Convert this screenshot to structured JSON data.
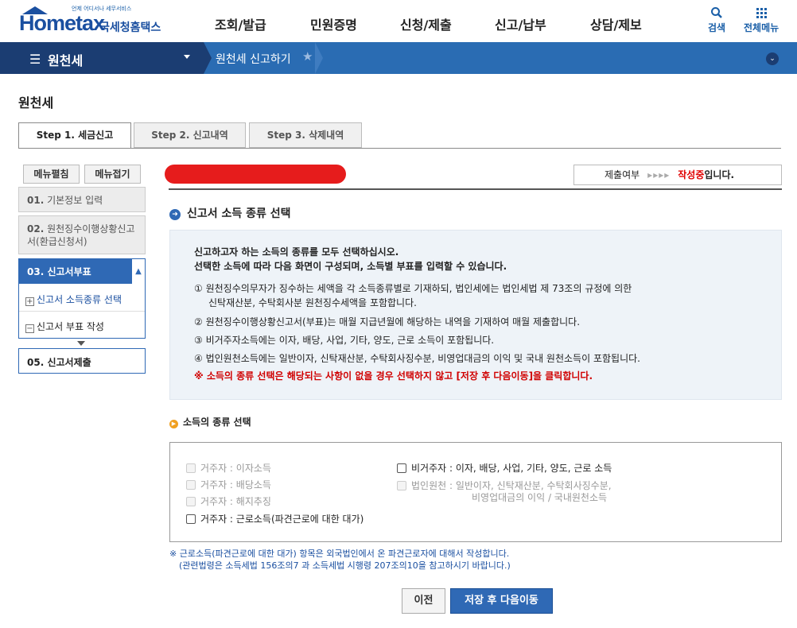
{
  "header": {
    "logo_tag": "언제 어디서나 세무서비스",
    "logo_word": "Hometax",
    "logo_kr": "국세청홈택스",
    "gnb": [
      "조회/발급",
      "민원증명",
      "신청/제출",
      "신고/납부",
      "상담/제보"
    ],
    "search_label": "검색",
    "allmenu_label": "전체메뉴"
  },
  "navbar": {
    "menu_label": "원천세",
    "crumb": "원천세 신고하기"
  },
  "page_title": "원천세",
  "tabs": [
    "Step 1. 세금신고",
    "Step 2. 신고내역",
    "Step 3. 삭제내역"
  ],
  "sidebar": {
    "expand_label": "메뉴펼침",
    "collapse_label": "메뉴접기",
    "steps": [
      {
        "num": "01.",
        "label": "기본정보 입력"
      },
      {
        "num": "02.",
        "label": "원천징수이행상황신고서(환급신청서)"
      },
      {
        "num": "03.",
        "label": "신고서부표"
      },
      {
        "num": "05.",
        "label": "신고서제출"
      }
    ],
    "sub_items": [
      "신고서 소득종류 선택",
      "신고서 부표 작성"
    ]
  },
  "status": {
    "label": "제출여부",
    "arrows": "▸▸▸▸",
    "value": "작성중",
    "suffix": "입니다."
  },
  "section_title": "신고서 소득 종류 선택",
  "info_lines": [
    "신고하고자 하는 소득의 종류를 모두 선택하십시오.",
    "선택한 소득에 따라 다음 화면이 구성되며, 소득별 부표를 입력할 수 있습니다.",
    "① 원천징수의무자가 징수하는 세액을 각 소득종류별로 기재하되, 법인세에는 법인세법 제 73조의 규정에 의한",
    "신탁재산분, 수탁회사분 원천징수세액을 포함합니다.",
    "② 원천징수이행상황신고서(부표)는 매월 지급년월에 해당하는 내역을 기재하여 매월 제출합니다.",
    "③ 비거주자소득에는 이자, 배당, 사업, 기타, 양도, 근로 소득이 포함됩니다.",
    "④ 법인원천소득에는 일반이자, 신탁재산분, 수탁회사징수분, 비영업대금의 이익 및 국내 원천소득이 포함됩니다.",
    "※ 소득의 종류 선택은 해당되는 사항이 없을 경우 선택하지 않고 [저장 후 다음이동]을 클릭합니다."
  ],
  "sub_title": "소득의 종류 선택",
  "options_left": [
    "거주자 : 이자소득",
    "거주자 : 배당소득",
    "거주자 : 해지추징",
    "거주자 : 근로소득(파견근로에 대한 대가)"
  ],
  "options_right": [
    "비거주자 : 이자, 배당, 사업, 기타, 양도, 근로 소득",
    "법인원천 : 일반이자, 신탁재산분, 수탁회사징수분,",
    "비영업대금의 이익 / 국내원천소득"
  ],
  "notes": [
    "※ 근로소득(파견근로에 대한 대가) 항목은 외국법인에서 온 파견근로자에 대해서 작성합니다.",
    "(관련법령은 소득세법 156조의7 과 소득세법 시행령 207조의10을 참고하시기 바랍니다.)"
  ],
  "buttons": {
    "prev": "이전",
    "next": "저장 후 다음이동"
  }
}
